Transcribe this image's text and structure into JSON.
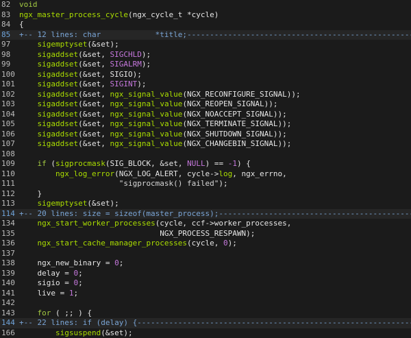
{
  "lines": [
    {
      "n": "82",
      "segs": [
        {
          "t": "void",
          "c": "kw"
        }
      ]
    },
    {
      "n": "83",
      "segs": [
        {
          "t": "ngx_master_process_cycle",
          "c": "fn"
        },
        {
          "t": "(ngx_cycle_t *cycle)",
          "c": "txt"
        }
      ]
    },
    {
      "n": "84",
      "segs": [
        {
          "t": "{",
          "c": "txt"
        }
      ]
    },
    {
      "n": "85",
      "fold": true,
      "cursor": true,
      "segs": [
        {
          "t": "+-- 12 lines: char            *title;------------------------------------------------------------",
          "c": "fold"
        }
      ]
    },
    {
      "n": "97",
      "segs": [
        {
          "t": "    ",
          "c": "txt"
        },
        {
          "t": "sigemptyset",
          "c": "fn"
        },
        {
          "t": "(&set);",
          "c": "txt"
        }
      ]
    },
    {
      "n": "98",
      "segs": [
        {
          "t": "    ",
          "c": "txt"
        },
        {
          "t": "sigaddset",
          "c": "fn"
        },
        {
          "t": "(&set, ",
          "c": "txt"
        },
        {
          "t": "SIGCHLD",
          "c": "mac"
        },
        {
          "t": ");",
          "c": "txt"
        }
      ]
    },
    {
      "n": "99",
      "segs": [
        {
          "t": "    ",
          "c": "txt"
        },
        {
          "t": "sigaddset",
          "c": "fn"
        },
        {
          "t": "(&set, ",
          "c": "txt"
        },
        {
          "t": "SIGALRM",
          "c": "mac"
        },
        {
          "t": ");",
          "c": "txt"
        }
      ]
    },
    {
      "n": "100",
      "segs": [
        {
          "t": "    ",
          "c": "txt"
        },
        {
          "t": "sigaddset",
          "c": "fn"
        },
        {
          "t": "(&set, SIGIO);",
          "c": "txt"
        }
      ]
    },
    {
      "n": "101",
      "segs": [
        {
          "t": "    ",
          "c": "txt"
        },
        {
          "t": "sigaddset",
          "c": "fn"
        },
        {
          "t": "(&set, ",
          "c": "txt"
        },
        {
          "t": "SIGINT",
          "c": "mac"
        },
        {
          "t": ");",
          "c": "txt"
        }
      ]
    },
    {
      "n": "102",
      "segs": [
        {
          "t": "    ",
          "c": "txt"
        },
        {
          "t": "sigaddset",
          "c": "fn"
        },
        {
          "t": "(&set, ",
          "c": "txt"
        },
        {
          "t": "ngx_signal_value",
          "c": "fn"
        },
        {
          "t": "(NGX_RECONFIGURE_SIGNAL));",
          "c": "txt"
        }
      ]
    },
    {
      "n": "103",
      "segs": [
        {
          "t": "    ",
          "c": "txt"
        },
        {
          "t": "sigaddset",
          "c": "fn"
        },
        {
          "t": "(&set, ",
          "c": "txt"
        },
        {
          "t": "ngx_signal_value",
          "c": "fn"
        },
        {
          "t": "(NGX_REOPEN_SIGNAL));",
          "c": "txt"
        }
      ]
    },
    {
      "n": "104",
      "segs": [
        {
          "t": "    ",
          "c": "txt"
        },
        {
          "t": "sigaddset",
          "c": "fn"
        },
        {
          "t": "(&set, ",
          "c": "txt"
        },
        {
          "t": "ngx_signal_value",
          "c": "fn"
        },
        {
          "t": "(NGX_NOACCEPT_SIGNAL));",
          "c": "txt"
        }
      ]
    },
    {
      "n": "105",
      "segs": [
        {
          "t": "    ",
          "c": "txt"
        },
        {
          "t": "sigaddset",
          "c": "fn"
        },
        {
          "t": "(&set, ",
          "c": "txt"
        },
        {
          "t": "ngx_signal_value",
          "c": "fn"
        },
        {
          "t": "(NGX_TERMINATE_SIGNAL));",
          "c": "txt"
        }
      ]
    },
    {
      "n": "106",
      "segs": [
        {
          "t": "    ",
          "c": "txt"
        },
        {
          "t": "sigaddset",
          "c": "fn"
        },
        {
          "t": "(&set, ",
          "c": "txt"
        },
        {
          "t": "ngx_signal_value",
          "c": "fn"
        },
        {
          "t": "(NGX_SHUTDOWN_SIGNAL));",
          "c": "txt"
        }
      ]
    },
    {
      "n": "107",
      "segs": [
        {
          "t": "    ",
          "c": "txt"
        },
        {
          "t": "sigaddset",
          "c": "fn"
        },
        {
          "t": "(&set, ",
          "c": "txt"
        },
        {
          "t": "ngx_signal_value",
          "c": "fn"
        },
        {
          "t": "(NGX_CHANGEBIN_SIGNAL));",
          "c": "txt"
        }
      ]
    },
    {
      "n": "108",
      "segs": []
    },
    {
      "n": "109",
      "segs": [
        {
          "t": "    ",
          "c": "txt"
        },
        {
          "t": "if",
          "c": "kw"
        },
        {
          "t": " (",
          "c": "txt"
        },
        {
          "t": "sigprocmask",
          "c": "fn"
        },
        {
          "t": "(SIG_BLOCK, &set, ",
          "c": "txt"
        },
        {
          "t": "NULL",
          "c": "mac"
        },
        {
          "t": ") == ",
          "c": "txt"
        },
        {
          "t": "-1",
          "c": "num"
        },
        {
          "t": ") {",
          "c": "txt"
        }
      ]
    },
    {
      "n": "110",
      "segs": [
        {
          "t": "        ",
          "c": "txt"
        },
        {
          "t": "ngx_log_error",
          "c": "fn"
        },
        {
          "t": "(NGX_LOG_ALERT, cycle->",
          "c": "txt"
        },
        {
          "t": "log",
          "c": "fn"
        },
        {
          "t": ", ngx_errno,",
          "c": "txt"
        }
      ]
    },
    {
      "n": "111",
      "segs": [
        {
          "t": "                      ",
          "c": "txt"
        },
        {
          "t": "\"sigprocmask() failed\"",
          "c": "str"
        },
        {
          "t": ");",
          "c": "txt"
        }
      ]
    },
    {
      "n": "112",
      "segs": [
        {
          "t": "    }",
          "c": "txt"
        }
      ]
    },
    {
      "n": "113",
      "segs": [
        {
          "t": "    ",
          "c": "txt"
        },
        {
          "t": "sigemptyset",
          "c": "fn"
        },
        {
          "t": "(&set);",
          "c": "txt"
        }
      ]
    },
    {
      "n": "114",
      "fold": true,
      "cursor": true,
      "segs": [
        {
          "t": "+-- 20 lines: size = sizeof(master_process);--------------------------------------------------------",
          "c": "fold"
        }
      ]
    },
    {
      "n": "134",
      "segs": [
        {
          "t": "    ",
          "c": "txt"
        },
        {
          "t": "ngx_start_worker_processes",
          "c": "fn"
        },
        {
          "t": "(cycle, ccf->worker_processes,",
          "c": "txt"
        }
      ]
    },
    {
      "n": "135",
      "segs": [
        {
          "t": "                               NGX_PROCESS_RESPAWN);",
          "c": "txt"
        }
      ]
    },
    {
      "n": "136",
      "segs": [
        {
          "t": "    ",
          "c": "txt"
        },
        {
          "t": "ngx_start_cache_manager_processes",
          "c": "fn"
        },
        {
          "t": "(cycle, ",
          "c": "txt"
        },
        {
          "t": "0",
          "c": "num"
        },
        {
          "t": ");",
          "c": "txt"
        }
      ]
    },
    {
      "n": "137",
      "segs": []
    },
    {
      "n": "138",
      "segs": [
        {
          "t": "    ngx_new_binary = ",
          "c": "txt"
        },
        {
          "t": "0",
          "c": "num"
        },
        {
          "t": ";",
          "c": "txt"
        }
      ]
    },
    {
      "n": "139",
      "segs": [
        {
          "t": "    delay = ",
          "c": "txt"
        },
        {
          "t": "0",
          "c": "num"
        },
        {
          "t": ";",
          "c": "txt"
        }
      ]
    },
    {
      "n": "140",
      "segs": [
        {
          "t": "    sigio = ",
          "c": "txt"
        },
        {
          "t": "0",
          "c": "num"
        },
        {
          "t": ";",
          "c": "txt"
        }
      ]
    },
    {
      "n": "141",
      "segs": [
        {
          "t": "    live = ",
          "c": "txt"
        },
        {
          "t": "1",
          "c": "num"
        },
        {
          "t": ";",
          "c": "txt"
        }
      ]
    },
    {
      "n": "142",
      "segs": []
    },
    {
      "n": "143",
      "segs": [
        {
          "t": "    ",
          "c": "txt"
        },
        {
          "t": "for",
          "c": "kw"
        },
        {
          "t": " ( ;; ) {",
          "c": "txt"
        }
      ]
    },
    {
      "n": "144",
      "fold": true,
      "cursor": true,
      "segs": [
        {
          "t": "+-- 22 lines: if (delay) {--------------------------------------------------------------------------",
          "c": "fold"
        }
      ]
    },
    {
      "n": "166",
      "segs": [
        {
          "t": "        ",
          "c": "txt"
        },
        {
          "t": "sigsuspend",
          "c": "fn"
        },
        {
          "t": "(&set);",
          "c": "txt"
        }
      ]
    }
  ]
}
